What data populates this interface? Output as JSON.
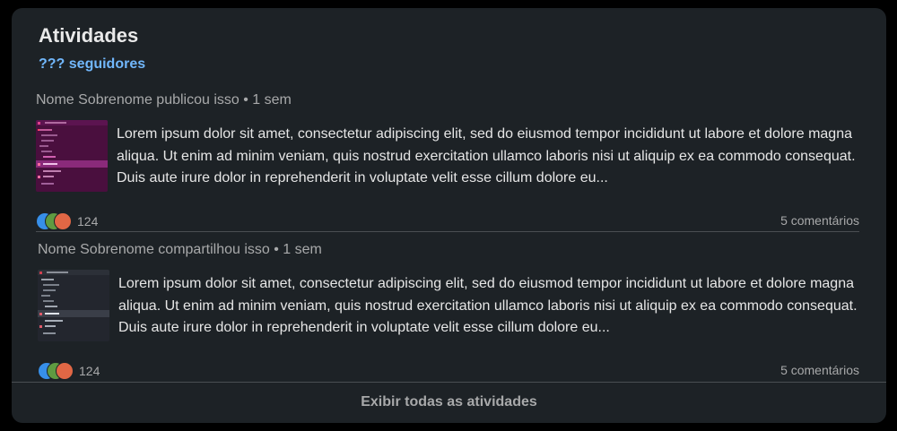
{
  "card": {
    "title": "Atividades",
    "followers": "??? seguidores"
  },
  "posts": [
    {
      "header": "Nome Sobrenome publicou isso • 1 sem",
      "text": "Lorem ipsum dolor sit amet, consectetur adipiscing elit, sed do eiusmod tempor incididunt ut labore et dolore magna aliqua. Ut enim ad minim veniam, quis nostrud exercitation ullamco laboris nisi ut aliquip ex ea commodo consequat. Duis aute irure dolor in reprehenderit in voluptate velit esse cillum dolore eu...",
      "reactions_count": "124",
      "comments": "5 comentários",
      "thumbnail": "purple-code-editor-screenshot"
    },
    {
      "header": "Nome Sobrenome compartilhou isso • 1 sem",
      "text": "Lorem ipsum dolor sit amet, consectetur adipiscing elit, sed do eiusmod tempor incididunt ut labore et dolore magna aliqua. Ut enim ad minim veniam, quis nostrud exercitation ullamco laboris nisi ut aliquip ex ea commodo consequat. Duis aute irure dolor in reprehenderit in voluptate velit esse cillum dolore eu...",
      "reactions_count": "124",
      "comments": "5 comentários",
      "thumbnail": "dark-code-editor-screenshot"
    }
  ],
  "footer": {
    "label": "Exibir todas as atividades"
  },
  "colors": {
    "card_bg": "#1d2226",
    "link": "#71b7fb",
    "reaction_like": "#378fe9",
    "reaction_celebrate": "#5f9b41",
    "reaction_love": "#e16745"
  }
}
